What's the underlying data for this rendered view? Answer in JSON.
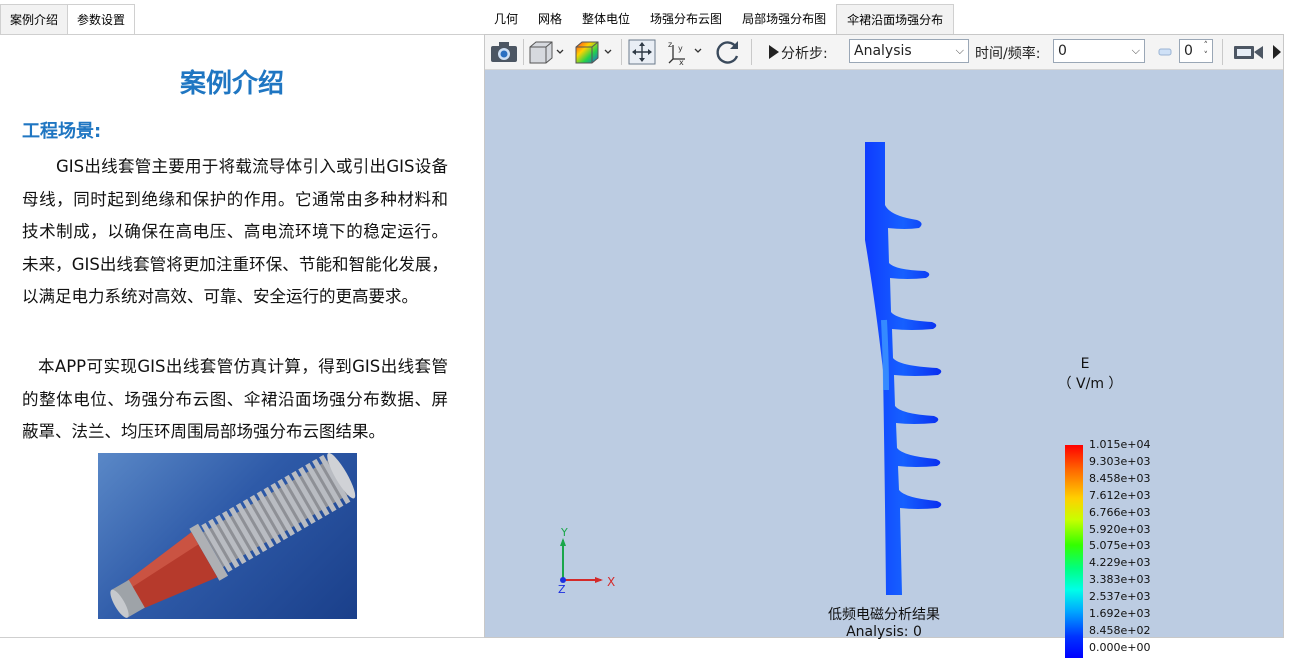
{
  "left_tabs": [
    {
      "label": "案例介绍",
      "active": true
    },
    {
      "label": "参数设置",
      "active": false
    }
  ],
  "doc": {
    "title": "案例介绍",
    "section_title": "工程场景:",
    "para1": "GIS出线套管主要用于将载流导体引入或引出GIS设备母线，同时起到绝缘和保护的作用。它通常由多种材料和技术制成，以确保在高电压、高电流环境下的稳定运行。未来，GIS出线套管将更加注重环保、节能和智能化发展，以满足电力系统对高效、可靠、安全运行的更高要求。",
    "para2": "本APP可实现GIS出线套管仿真计算，得到GIS出线套管的整体电位、场强分布云图、伞裙沿面场强分布数据、屏蔽罩、法兰、均压环周围局部场强分布云图结果。"
  },
  "right_tabs": [
    {
      "label": "几何",
      "active": false
    },
    {
      "label": "网格",
      "active": false
    },
    {
      "label": "整体电位",
      "active": false
    },
    {
      "label": "场强分布云图",
      "active": false
    },
    {
      "label": "局部场强分布图",
      "active": false
    },
    {
      "label": "伞裙沿面场强分布",
      "active": true
    }
  ],
  "toolbar": {
    "analysis_step_label": "分析步:",
    "analysis_step_value": "Analysis",
    "time_freq_label": "时间/频率:",
    "time_freq_value": "0",
    "frame_value": "0",
    "icons": [
      "camera-icon",
      "cube-view-icon",
      "color-cube-icon",
      "move-icon",
      "axes-icon",
      "rotate-icon",
      "play-icon",
      "video-camera-icon"
    ]
  },
  "viewer": {
    "caption_line1": "低频电磁分析结果",
    "caption_line2": "Analysis: 0",
    "legend_title_line1": "E",
    "legend_title_line2": "（ V/m ）",
    "legend_ticks": [
      "1.015e+04",
      "9.303e+03",
      "8.458e+03",
      "7.612e+03",
      "6.766e+03",
      "5.920e+03",
      "5.075e+03",
      "4.229e+03",
      "3.383e+03",
      "2.537e+03",
      "1.692e+03",
      "8.458e+02",
      "0.000e+00"
    ],
    "axis_labels": {
      "x": "X",
      "y": "Y",
      "z": "Z"
    }
  }
}
